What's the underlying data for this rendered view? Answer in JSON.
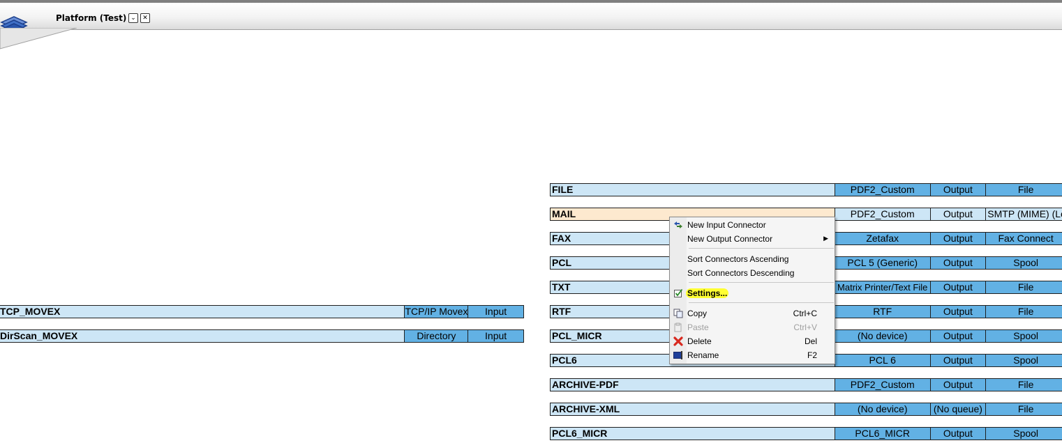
{
  "header": {
    "title": "Platform (Test)",
    "dropdown_icon": "chevron-down-icon",
    "close_icon": "close-icon"
  },
  "input_connectors": [
    {
      "name": "TCP_MOVEX",
      "device": "TCP/IP Movex",
      "direction": "Input"
    },
    {
      "name": "DirScan_MOVEX",
      "device": "Directory",
      "direction": "Input"
    }
  ],
  "output_connectors": [
    {
      "name": "FILE",
      "device": "PDF2_Custom",
      "queue": "Output",
      "type": "File"
    },
    {
      "name": "MAIL",
      "device": "PDF2_Custom",
      "queue": "Output",
      "type": "SMTP (MIME) (Le",
      "selected": true
    },
    {
      "name": "FAX",
      "device": "Zetafax",
      "queue": "Output",
      "type": "Fax Connect"
    },
    {
      "name": "PCL",
      "device": "PCL 5 (Generic)",
      "queue": "Output",
      "type": "Spool"
    },
    {
      "name": "TXT",
      "device": "Matrix Printer/Text File",
      "queue": "Output",
      "type": "File"
    },
    {
      "name": "RTF",
      "device": "RTF",
      "queue": "Output",
      "type": "File"
    },
    {
      "name": "PCL_MICR",
      "device": "(No device)",
      "queue": "Output",
      "type": "Spool"
    },
    {
      "name": "PCL6",
      "device": "PCL 6",
      "queue": "Output",
      "type": "Spool"
    },
    {
      "name": "ARCHIVE-PDF",
      "device": "PDF2_Custom",
      "queue": "Output",
      "type": "File"
    },
    {
      "name": "ARCHIVE-XML",
      "device": "(No device)",
      "queue": "(No queue)",
      "type": "File"
    },
    {
      "name": "PCL6_MICR",
      "device": "PCL6_MICR",
      "queue": "Output",
      "type": "Spool"
    }
  ],
  "context_menu": {
    "new_input_connector": "New Input Connector",
    "new_output_connector": "New Output Connector",
    "sort_ascending": "Sort Connectors Ascending",
    "sort_descending": "Sort Connectors Descending",
    "settings": "Settings...",
    "copy": "Copy",
    "copy_shortcut": "Ctrl+C",
    "paste": "Paste",
    "paste_shortcut": "Ctrl+V",
    "delete": "Delete",
    "delete_shortcut": "Del",
    "rename": "Rename",
    "rename_shortcut": "F2",
    "icons": [
      "new-connector-icon",
      "settings-icon",
      "copy-icon",
      "paste-icon",
      "delete-icon",
      "rename-icon",
      "submenu-arrow-icon"
    ],
    "highlight_color": "#ffff33"
  },
  "colors": {
    "name_cell": "#cde6f6",
    "selected_name_cell": "#fde9cf",
    "column_cell": "#62b1e4"
  }
}
